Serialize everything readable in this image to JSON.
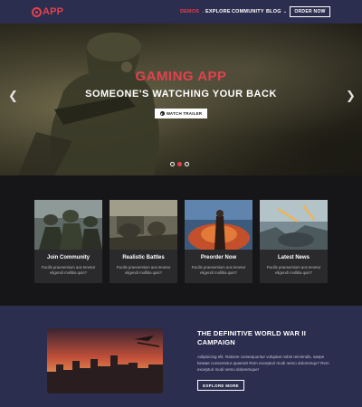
{
  "nav": {
    "logo_text": "APP",
    "items": [
      {
        "label": "DEMOS",
        "dropdown": true,
        "active": true
      },
      {
        "label": "EXPLORE",
        "dropdown": false,
        "active": false
      },
      {
        "label": "COMMUNITY",
        "dropdown": false,
        "active": false
      },
      {
        "label": "BLOG",
        "dropdown": true,
        "active": false
      }
    ],
    "order_label": "ORDER NOW"
  },
  "hero": {
    "title": "GAMING APP",
    "subtitle": "SOMEONE'S WATCHING YOUR BACK",
    "trailer_label": "WATCH TRAILER",
    "prev_icon": "chevron-left-icon",
    "next_icon": "chevron-right-icon",
    "slides": 3,
    "active_slide": 2
  },
  "features": {
    "cards": [
      {
        "title": "Join Community",
        "text": "Facilis praesentium aos tenetur eligendi mollitia quis?"
      },
      {
        "title": "Realistic Battles",
        "text": "Facilis praesentium aos tenetur eligendi mollitia quis?"
      },
      {
        "title": "Preorder Now",
        "text": "Facilis praesentium aos tenetur eligendi mollitia quis?"
      },
      {
        "title": "Latest News",
        "text": "Facilis praesentium aos tenetur eligendi mollitia quis?"
      }
    ]
  },
  "campaign": {
    "title": "THE DEFINITIVE WORLD WAR II CAMPAIGN",
    "text": "Adipisicing elit. Ratione consequuntur voluptas nobis reiciendis, saepe beatae consectetur quaerat! Rem excepturi modi nemo doloremqu? Rem excepturi modi nemo doloremque!",
    "button_label": "EXPLORE MORE"
  },
  "colors": {
    "accent": "#e2414f",
    "nav_bg": "#2c2e4f",
    "dark_bg": "#161618",
    "card_bg": "#2a2a2d"
  }
}
